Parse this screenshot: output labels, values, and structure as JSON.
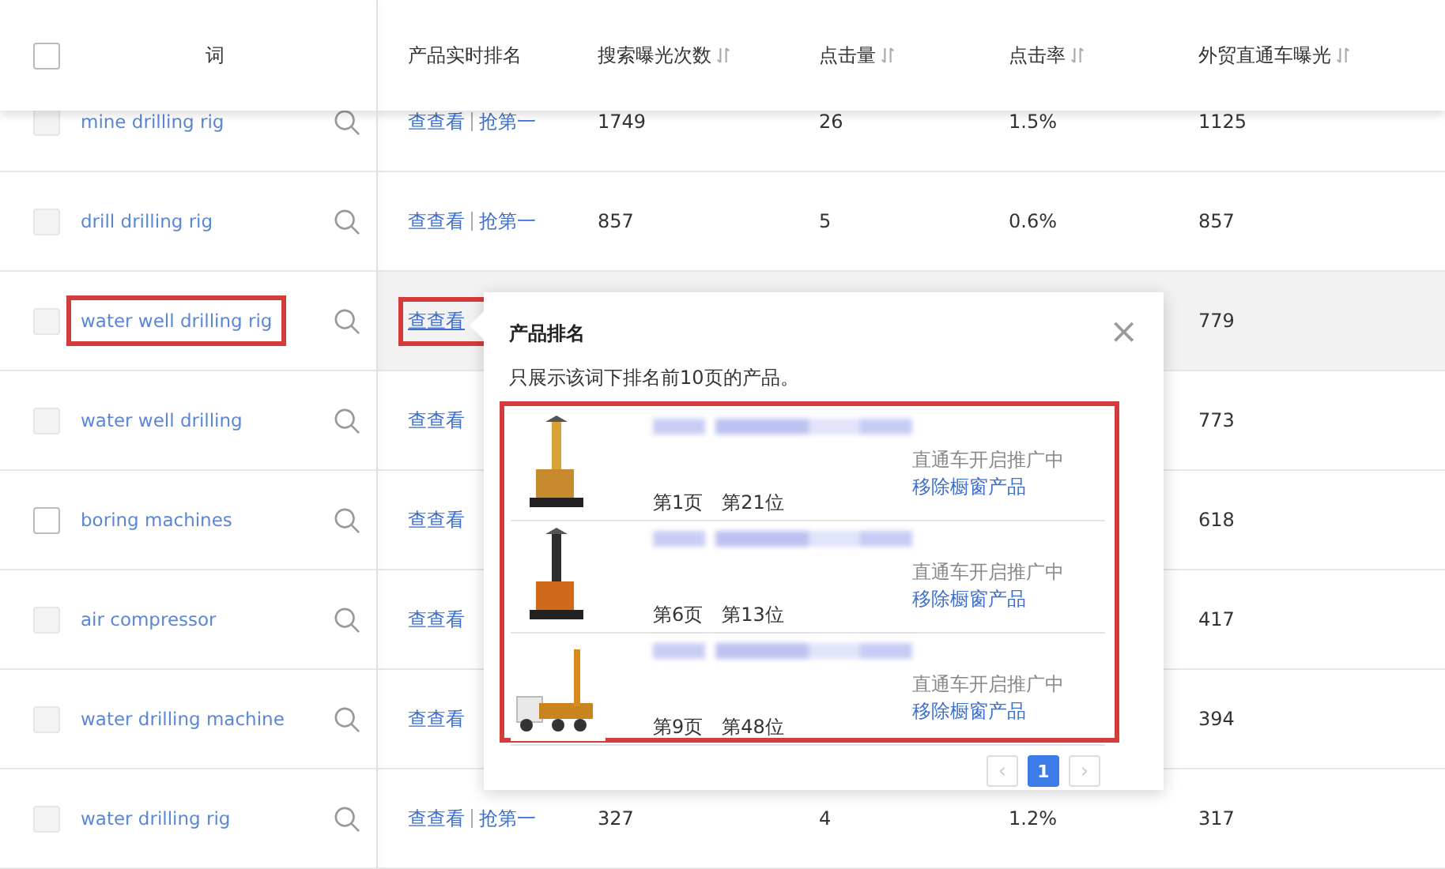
{
  "table": {
    "header_checkbox": {
      "checked": false,
      "disabled": false
    },
    "columns": [
      {
        "label": "词",
        "sortable": false
      },
      {
        "label": "产品实时排名",
        "sortable": false
      },
      {
        "label": "搜索曝光次数",
        "sortable": true
      },
      {
        "label": "点击量",
        "sortable": true
      },
      {
        "label": "点击率",
        "sortable": true
      },
      {
        "label": "外贸直通车曝光",
        "sortable": true
      }
    ],
    "rows": [
      {
        "keyword": "mine drilling rig",
        "checkbox_disabled": true,
        "selected": false,
        "annotated": false,
        "view": "查查看",
        "grab": "抢第一",
        "impressions": "1749",
        "clicks": "26",
        "ctr": "1.5%",
        "exposure": "1125"
      },
      {
        "keyword": "drill drilling rig",
        "checkbox_disabled": true,
        "selected": false,
        "annotated": false,
        "view": "查查看",
        "grab": "抢第一",
        "impressions": "857",
        "clicks": "5",
        "ctr": "0.6%",
        "exposure": "857"
      },
      {
        "keyword": "water well drilling rig",
        "checkbox_disabled": true,
        "selected": true,
        "annotated": true,
        "view": "查查看",
        "exposure": "779"
      },
      {
        "keyword": "water well drilling",
        "checkbox_disabled": true,
        "selected": false,
        "annotated": false,
        "view": "查查看",
        "exposure": "773"
      },
      {
        "keyword": "boring machines",
        "checkbox_disabled": false,
        "selected": false,
        "annotated": false,
        "view": "查查看",
        "exposure": "618"
      },
      {
        "keyword": "air compressor",
        "checkbox_disabled": true,
        "selected": false,
        "annotated": false,
        "view": "查查看",
        "exposure": "417"
      },
      {
        "keyword": "water drilling machine",
        "checkbox_disabled": true,
        "selected": false,
        "annotated": false,
        "view": "查查看",
        "exposure": "394"
      },
      {
        "keyword": "water drilling rig",
        "checkbox_disabled": true,
        "selected": false,
        "annotated": false,
        "view": "查查看",
        "grab": "抢第一",
        "impressions": "327",
        "clicks": "4",
        "ctr": "1.2%",
        "exposure": "317"
      }
    ]
  },
  "popup": {
    "title": "产品排名",
    "close": "×",
    "note": "只展示该词下排名前10页的产品。",
    "annotated": true,
    "products": [
      {
        "rank": "第1页　第21位",
        "status": "直通车开启推广中",
        "action": "移除橱窗产品"
      },
      {
        "rank": "第6页　第13位",
        "status": "直通车开启推广中",
        "action": "移除橱窗产品"
      },
      {
        "rank": "第9页　第48位",
        "status": "直通车开启推广中",
        "action": "移除橱窗产品"
      }
    ],
    "pagination": {
      "prev": "‹",
      "next": "›",
      "prev_disabled": true,
      "next_disabled": true,
      "pages": [
        {
          "label": "1",
          "selected": true
        }
      ]
    }
  }
}
